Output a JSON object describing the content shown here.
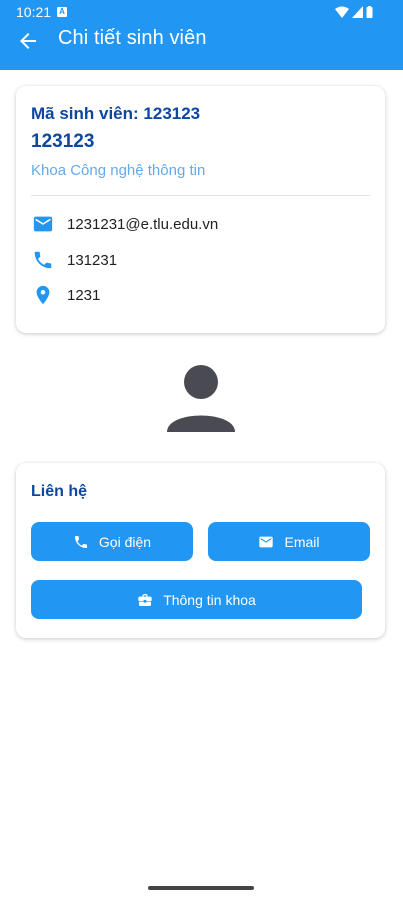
{
  "status_bar": {
    "time": "10:21",
    "badge": "A"
  },
  "app_bar": {
    "title": "Chi tiết sinh viên"
  },
  "student": {
    "code_label": "Mã sinh viên: 123123",
    "name": "123123",
    "department": "Khoa Công nghệ thông tin",
    "email": "1231231@e.tlu.edu.vn",
    "phone": "131231",
    "address": "1231"
  },
  "contact": {
    "heading": "Liên hệ",
    "call_label": "Gọi điện",
    "email_label": "Email",
    "faculty_label": "Thông tin khoa"
  },
  "colors": {
    "primary": "#2196f3",
    "heading": "#0d47a1",
    "secondary_text": "#64a9ec",
    "avatar": "#4a4a52"
  },
  "icons": [
    "arrow-back-icon",
    "email-icon",
    "phone-icon",
    "location-pin-icon",
    "person-avatar-icon",
    "briefcase-icon"
  ]
}
